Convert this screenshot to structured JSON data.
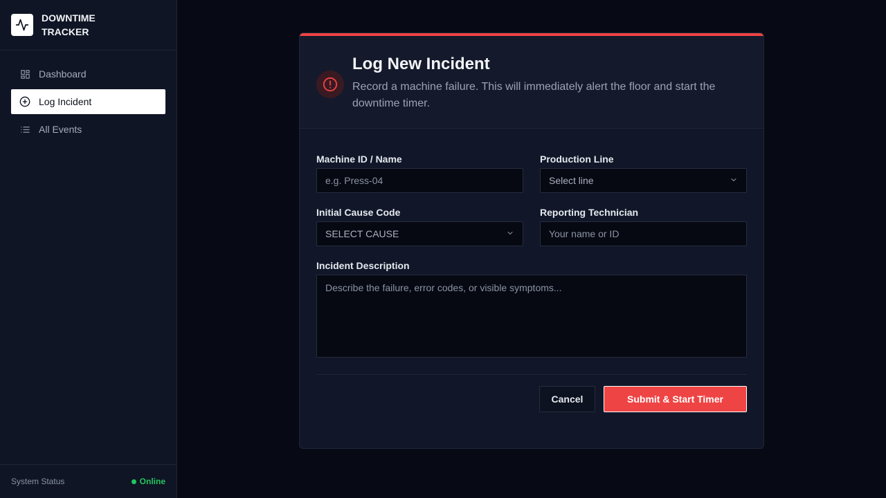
{
  "brand": {
    "title": "DOWNTIME TRACKER",
    "logo_icon": "activity-pulse-icon"
  },
  "nav": {
    "items": [
      {
        "label": "Dashboard",
        "icon": "grid-icon",
        "active": false
      },
      {
        "label": "Log Incident",
        "icon": "plus-circle-icon",
        "active": true
      },
      {
        "label": "All Events",
        "icon": "list-icon",
        "active": false
      }
    ]
  },
  "footer": {
    "status_label": "System Status",
    "status_value": "Online",
    "status_color": "#22c55e"
  },
  "card": {
    "title": "Log New Incident",
    "subtitle": "Record a machine failure. This will immediately alert the floor and start the downtime timer.",
    "accent": "#ef4444",
    "icon": "alert-circle-icon"
  },
  "form": {
    "machine": {
      "label": "Machine ID / Name",
      "placeholder": "e.g. Press-04"
    },
    "line": {
      "label": "Production Line",
      "value": "Select line"
    },
    "cause": {
      "label": "Initial Cause Code",
      "value": "SELECT CAUSE"
    },
    "tech": {
      "label": "Reporting Technician",
      "placeholder": "Your name or ID"
    },
    "description": {
      "label": "Incident Description",
      "placeholder": "Describe the failure, error codes, or visible symptoms..."
    }
  },
  "actions": {
    "cancel": "Cancel",
    "submit": "Submit & Start Timer"
  }
}
